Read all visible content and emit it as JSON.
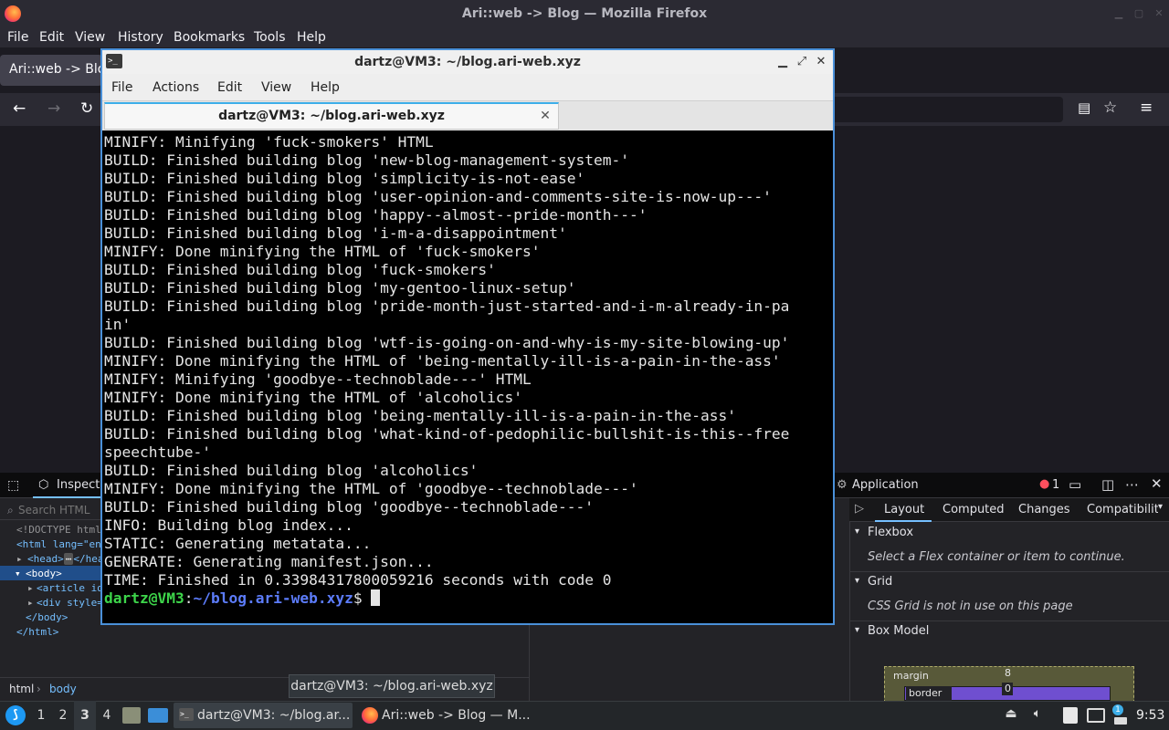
{
  "firefox": {
    "window_title": "Ari::web -> Blog — Mozilla Firefox",
    "menu": [
      "File",
      "Edit",
      "View",
      "History",
      "Bookmarks",
      "Tools",
      "Help"
    ],
    "tab_label": "Ari::web -> Blog",
    "accent": "#ff7139"
  },
  "devtools": {
    "inspector_tab": "Inspector",
    "application_tab": "Application",
    "error_count": "1",
    "search_placeholder": "Search HTML",
    "html_tree": {
      "doctype": "<!DOCTYPE html>",
      "html_open": "<html lang=\"en\">",
      "head": "<head>",
      "head_close": "</head>",
      "body": "<body>",
      "article": "<article id",
      "div": "<div style=",
      "body_close": "</body>",
      "html_close": "</html>"
    },
    "breadcrumb": [
      "html",
      "body"
    ],
    "side_tabs": [
      "Layout",
      "Computed",
      "Changes",
      "Compatibility"
    ],
    "sections": {
      "flexbox": "Flexbox",
      "flexbox_msg": "Select a Flex container or item to continue.",
      "grid": "Grid",
      "grid_msg": "CSS Grid is not in use on this page",
      "box_model": "Box Model"
    },
    "box_model": {
      "margin_label": "margin",
      "margin_top": "8",
      "border_label": "border",
      "border_top": "0"
    }
  },
  "terminal": {
    "window_title": "dartz@VM3: ~/blog.ari-web.xyz",
    "menu": [
      "File",
      "Actions",
      "Edit",
      "View",
      "Help"
    ],
    "tab_label": "dartz@VM3: ~/blog.ari-web.xyz",
    "lines": [
      "MINIFY: Minifying 'fuck-smokers' HTML",
      "BUILD: Finished building blog 'new-blog-management-system-'",
      "BUILD: Finished building blog 'simplicity-is-not-ease'",
      "BUILD: Finished building blog 'user-opinion-and-comments-site-is-now-up---'",
      "BUILD: Finished building blog 'happy--almost--pride-month---'",
      "BUILD: Finished building blog 'i-m-a-disappointment'",
      "MINIFY: Done minifying the HTML of 'fuck-smokers'",
      "BUILD: Finished building blog 'fuck-smokers'",
      "BUILD: Finished building blog 'my-gentoo-linux-setup'",
      "BUILD: Finished building blog 'pride-month-just-started-and-i-m-already-in-pa",
      "in'",
      "BUILD: Finished building blog 'wtf-is-going-on-and-why-is-my-site-blowing-up'",
      "MINIFY: Done minifying the HTML of 'being-mentally-ill-is-a-pain-in-the-ass'",
      "MINIFY: Minifying 'goodbye--technoblade---' HTML",
      "MINIFY: Done minifying the HTML of 'alcoholics'",
      "BUILD: Finished building blog 'being-mentally-ill-is-a-pain-in-the-ass'",
      "BUILD: Finished building blog 'what-kind-of-pedophilic-bullshit-is-this--free",
      "speechtube-'",
      "BUILD: Finished building blog 'alcoholics'",
      "MINIFY: Done minifying the HTML of 'goodbye--technoblade---'",
      "BUILD: Finished building blog 'goodbye--technoblade---'",
      "INFO: Building blog index...",
      "STATIC: Generating metatata...",
      "GENERATE: Generating manifest.json...",
      "TIME: Finished in 0.33984317800059216 seconds with code 0"
    ],
    "prompt": {
      "user_host": "dartz@VM3",
      "colon": ":",
      "path": "~/blog.ari-web.xyz",
      "dollar": "$ "
    },
    "colors": {
      "user": "#3dd44a",
      "path": "#5c7cfa",
      "accent": "#3daee9"
    }
  },
  "tooltip": "dartz@VM3: ~/blog.ari-web.xyz",
  "taskbar": {
    "workspaces": [
      "1",
      "2",
      "3",
      "4"
    ],
    "active_workspace": "3",
    "tasks": [
      {
        "label": "dartz@VM3: ~/blog.ar...",
        "icon": "terminal-icon"
      },
      {
        "label": "Ari::web -> Blog — M...",
        "icon": "firefox-icon"
      }
    ],
    "clock": "9:53",
    "notification_count": "1"
  }
}
